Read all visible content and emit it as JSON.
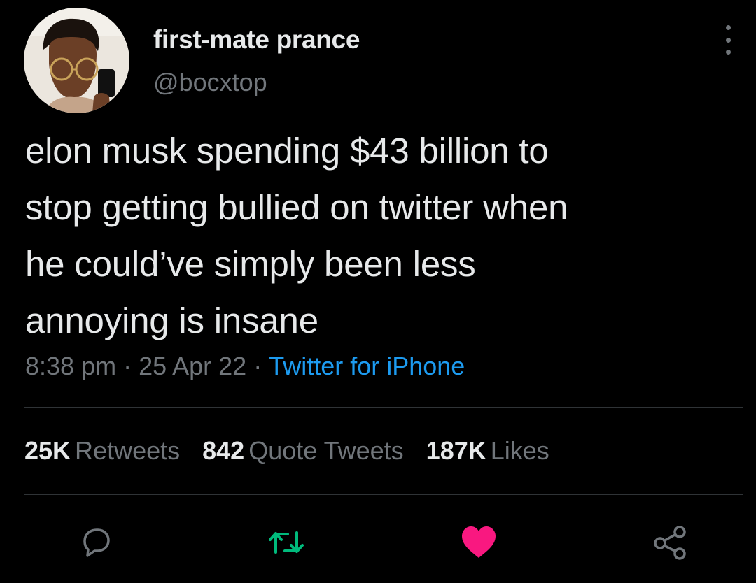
{
  "author": {
    "display_name": "first-mate prance",
    "handle": "@bocxtop"
  },
  "tweet": {
    "text": "elon musk spending $43 billion to\nstop getting bullied on twitter when\nhe could’ve simply been less\nannoying is insane",
    "time": "8:38 pm",
    "date": "25 Apr 22",
    "separator": "·",
    "source": "Twitter for iPhone"
  },
  "stats": {
    "retweets": {
      "count": "25K",
      "label": "Retweets"
    },
    "quotes": {
      "count": "842",
      "label": "Quote Tweets"
    },
    "likes": {
      "count": "187K",
      "label": "Likes"
    }
  },
  "actions": {
    "reply_icon": "reply-bubble-icon",
    "retweet_icon": "retweet-arrows-icon",
    "like_icon": "heart-filled-icon",
    "share_icon": "share-nodes-icon"
  },
  "colors": {
    "background": "#000000",
    "text": "#e7e9ea",
    "secondary": "#71767b",
    "link": "#1d9bf0",
    "retweet_active": "#00ba7c",
    "like_active": "#f91880"
  }
}
